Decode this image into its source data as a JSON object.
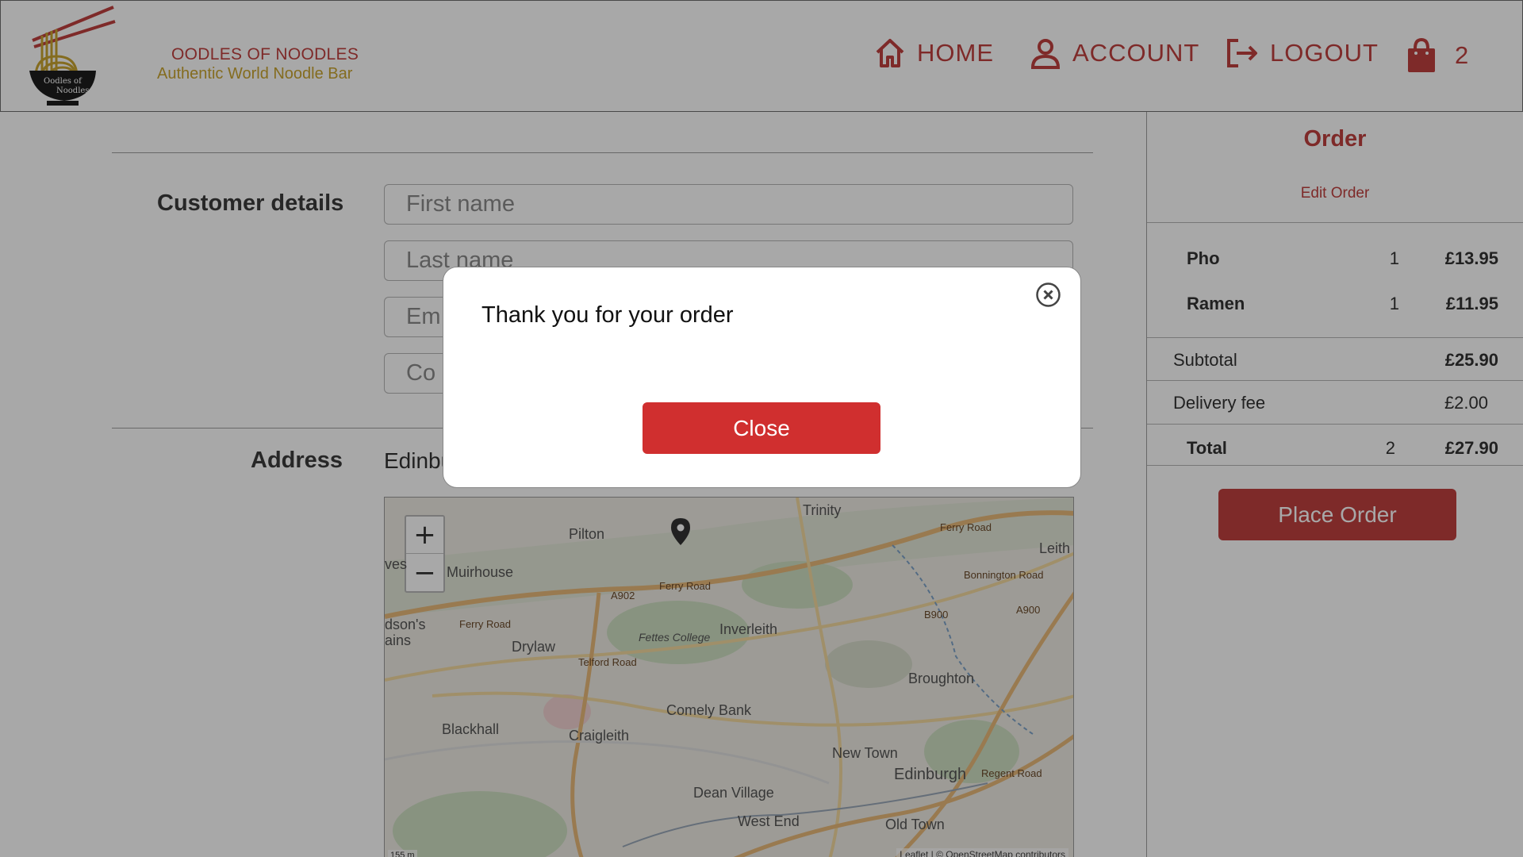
{
  "brand": {
    "name": "OODLES OF NOODLES",
    "tagline": "Authentic World Noodle Bar",
    "logo_text_top": "Oodles of",
    "logo_text_bottom": "Noodles"
  },
  "nav": {
    "home_label": "HOME",
    "account_label": "ACCOUNT",
    "logout_label": "LOGOUT",
    "cart_count": "2",
    "icons": [
      "home-icon",
      "account-icon",
      "logout-icon",
      "shopping-bag-icon"
    ]
  },
  "form": {
    "customer_section_label": "Customer details",
    "first_name_placeholder": "First name",
    "last_name_placeholder": "Last name",
    "email_placeholder_visible": "Em",
    "contact_placeholder_visible": "Co",
    "address_section_label": "Address",
    "address_value": "Edinbu"
  },
  "map": {
    "zoom_in": "+",
    "zoom_out": "−",
    "places": [
      "Trinity",
      "Pilton",
      "Leith",
      "Muirhouse",
      "Inverleith",
      "Drylaw",
      "Fettes College",
      "Broughton",
      "Comely Bank",
      "Blackhall",
      "Craigleith",
      "New Town",
      "Edinburgh",
      "Dean Village",
      "West End",
      "Old Town"
    ],
    "roads": [
      "Ferry Road",
      "A902",
      "Ferry Road",
      "Ferry Road",
      "Bonnington Road",
      "B900",
      "A900",
      "Telford Road",
      "Regent Road"
    ],
    "edge_labels": [
      "ves",
      "dson's",
      "ains"
    ],
    "attribution": "Leaflet | © OpenStreetMap contributors",
    "scale": "155 m"
  },
  "order": {
    "title": "Order",
    "edit_label": "Edit Order",
    "items": [
      {
        "name": "Pho",
        "qty": "1",
        "price": "£13.95"
      },
      {
        "name": "Ramen",
        "qty": "1",
        "price": "£11.95"
      }
    ],
    "subtotal_label": "Subtotal",
    "subtotal_value": "£25.90",
    "delivery_label": "Delivery fee",
    "delivery_value": "£2.00",
    "total_label": "Total",
    "total_qty": "2",
    "total_value": "£27.90",
    "place_order_label": "Place Order"
  },
  "modal": {
    "message": "Thank you for your order",
    "close_label": "Close"
  },
  "colors": {
    "brand_red": "#c0403f",
    "brand_gold": "#c9a42f",
    "button_red": "#d02f2f"
  }
}
